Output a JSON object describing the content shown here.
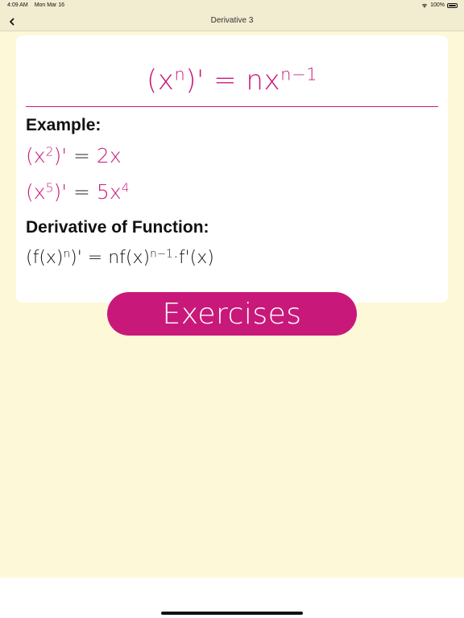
{
  "status_bar": {
    "time": "4:09 AM",
    "date": "Mon Mar 16",
    "battery": "100%",
    "battery_level": 1.0
  },
  "nav": {
    "title": "Derivative 3",
    "back_icon": "chevron-left-icon"
  },
  "card": {
    "main_formula": {
      "base": "(x",
      "exp": "n",
      "close": ")'",
      "eq": " = nx",
      "exp2": "n−1"
    },
    "example_heading": "Example:",
    "examples": [
      {
        "lhs_open": "(x",
        "lhs_exp": "2",
        "lhs_close": ")'",
        "eq": " = ",
        "rhs": "2x",
        "rhs_exp": ""
      },
      {
        "lhs_open": "(x",
        "lhs_exp": "5",
        "lhs_close": ")'",
        "eq": " = ",
        "rhs": "5x",
        "rhs_exp": "4"
      }
    ],
    "function_heading": "Derivative of Function:",
    "function_formula": {
      "part1": "(f(x)",
      "exp1": "n",
      "part2": ")' = nf(x)",
      "exp2": "n−1",
      "part3": "·f'(x)"
    }
  },
  "exercises_button": {
    "label": "Exercises"
  },
  "colors": {
    "accent": "#c8197a",
    "background": "#fdf8d8",
    "bar": "#f2ecd1"
  }
}
